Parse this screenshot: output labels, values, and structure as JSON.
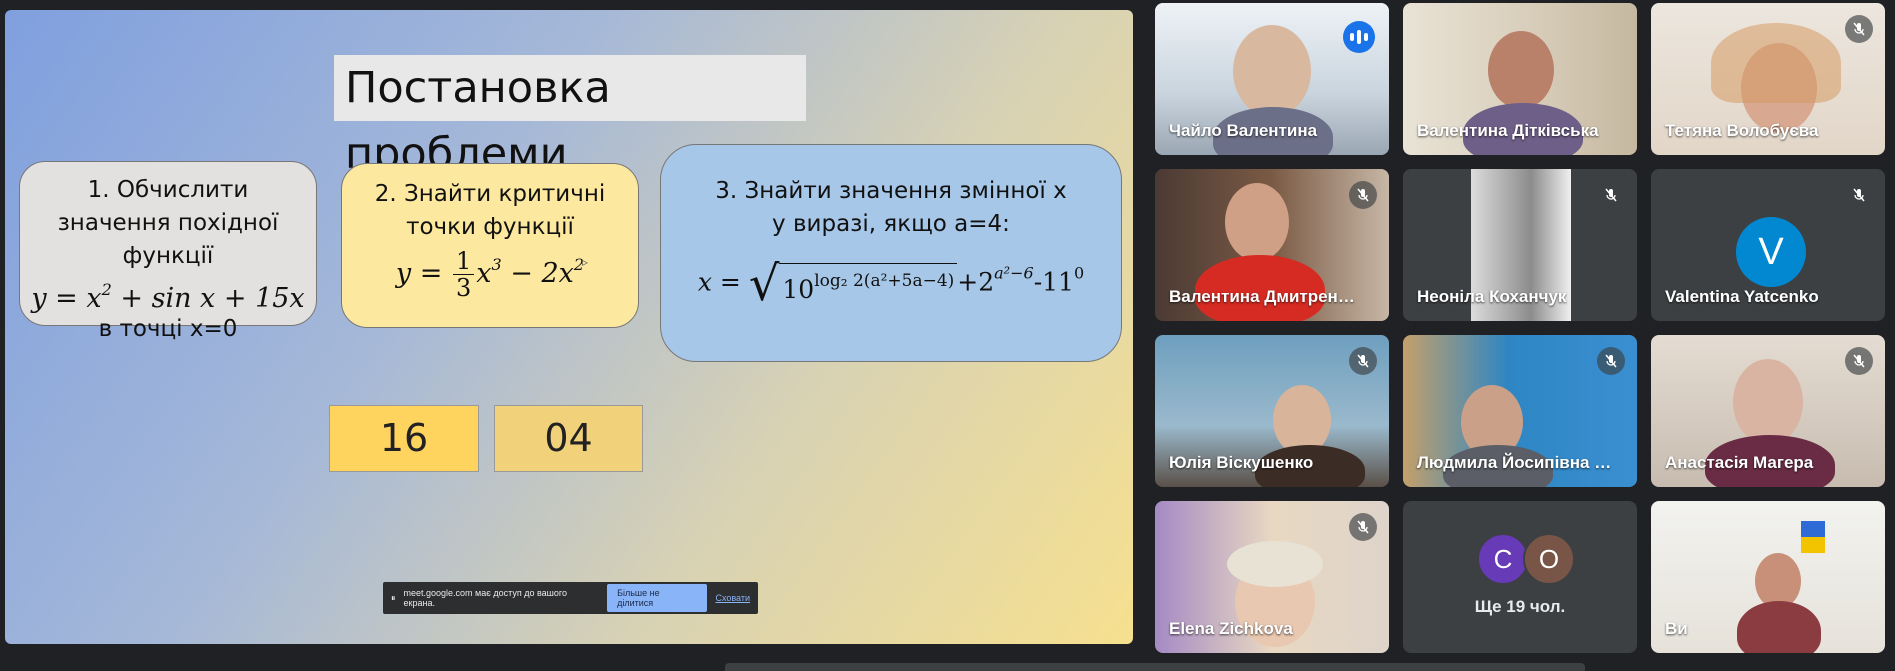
{
  "slide": {
    "title": "Постановка проблеми",
    "task1": {
      "text_lines": [
        "1. Обчислити",
        "значення похідної",
        "функції"
      ],
      "formula": {
        "lhs": "y = x",
        "exp": "2",
        "rest": " + sin x + 15x"
      },
      "tail": "в точці х=0"
    },
    "task2": {
      "text_lines": [
        "2. Знайти критичні",
        "точки функції"
      ],
      "formula": {
        "lhs": "y =",
        "num": "1",
        "den": "3",
        "mid": "x",
        "exp1": "3",
        "rest": " − 2x",
        "exp2": "2"
      }
    },
    "task3": {
      "text_lines": [
        "3. Знайти значення змінної х",
        "у виразі, якщо а=4:"
      ],
      "formula": {
        "lhs": "x =",
        "radicand": "10",
        "exp_inner": "log₂ 2(a²+5a−4)",
        "tail1": "+2",
        "exp2": "a²−6",
        "tail2": "-11",
        "exp3": "0"
      }
    },
    "timer": {
      "minutes": "16",
      "seconds": "04"
    },
    "share_bar": {
      "message": "meet.google.com має доступ до вашого екрана.",
      "stop_label": "Більше не ділитися",
      "hide_label": "Сховати"
    }
  },
  "participants": [
    {
      "name": "Чайло Валентина",
      "speaking": true
    },
    {
      "name": "Валентина Дітківська",
      "muted": false
    },
    {
      "name": "Тетяна Волобуєва",
      "muted": true
    },
    {
      "name": "Валентина Дмитрен…",
      "muted": true
    },
    {
      "name": "Неоніла Коханчук",
      "muted": true
    },
    {
      "name": "Valentina Yatcenko",
      "muted": true,
      "avatar_letter": "V",
      "avatar_color": "#0288d1"
    },
    {
      "name": "Юлія Віскушенко",
      "muted": true
    },
    {
      "name": "Людмила Йосипівна …",
      "muted": true
    },
    {
      "name": "Анастасія Магера",
      "muted": true
    },
    {
      "name": "Elena Zichkova",
      "muted": true
    },
    {
      "name": "Ще 19 чол.",
      "more_avatars": [
        "C",
        "O"
      ]
    },
    {
      "name": "Ви"
    }
  ],
  "colors": {
    "accent": "#1a73e8",
    "tile_bg": "#3c4043",
    "page_bg": "#202124"
  }
}
